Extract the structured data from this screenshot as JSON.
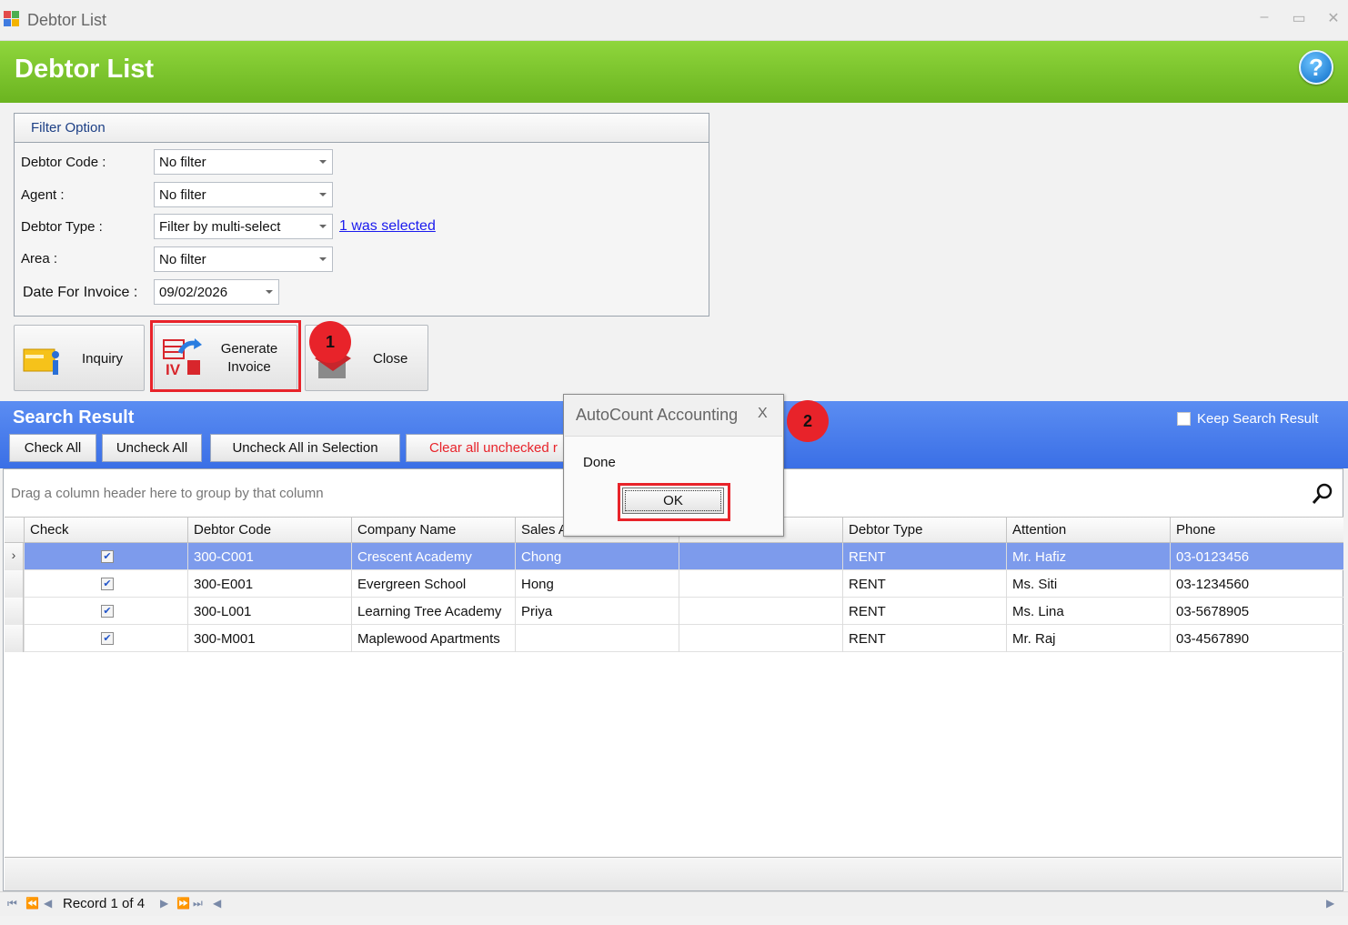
{
  "window": {
    "title": "Debtor List",
    "min": "–",
    "max": "▭",
    "close": "✕"
  },
  "header": {
    "title": "Debtor List",
    "help": "?"
  },
  "filter": {
    "caption": "Filter Option",
    "debtor_code_label": "Debtor Code :",
    "debtor_code_value": "No filter",
    "agent_label": "Agent :",
    "agent_value": "No filter",
    "debtor_type_label": "Debtor Type :",
    "debtor_type_value": "Filter by multi-select",
    "debtor_type_link": "1 was selected",
    "area_label": "Area :",
    "area_value": "No filter",
    "date_label": "Date For Invoice :",
    "date_value": "09/02/2026"
  },
  "actions": {
    "inquiry": "Inquiry",
    "generate_line1": "Generate",
    "generate_line2": "Invoice",
    "close": "Close"
  },
  "annotations": {
    "badge1": "1",
    "badge2": "2"
  },
  "search_result": {
    "title": "Search Result",
    "check_all": "Check All",
    "uncheck_all": "Uncheck All",
    "uncheck_all_selection": "Uncheck All in Selection",
    "clear_unchecked": "Clear all unchecked r",
    "keep_label": "Keep Search Result"
  },
  "grid": {
    "group_hint": "Drag a column header here to group by that column",
    "columns": [
      "Check",
      "Debtor Code",
      "Company Name",
      "Sales A",
      "",
      "Debtor Type",
      "Attention",
      "Phone"
    ],
    "rows": [
      {
        "code": "300-C001",
        "company": "Crescent Academy",
        "sales": "Chong",
        "type": "RENT",
        "attention": "Mr. Hafiz",
        "phone": "03-0123456"
      },
      {
        "code": "300-E001",
        "company": "Evergreen School",
        "sales": "Hong",
        "type": "RENT",
        "attention": "Ms. Siti",
        "phone": "03-1234560"
      },
      {
        "code": "300-L001",
        "company": "Learning Tree Academy",
        "sales": "Priya",
        "type": "RENT",
        "attention": "Ms. Lina",
        "phone": "03-5678905"
      },
      {
        "code": "300-M001",
        "company": "Maplewood Apartments",
        "sales": "",
        "type": "RENT",
        "attention": "Mr. Raj",
        "phone": "03-4567890"
      }
    ],
    "record_text": "Record 1 of 4"
  },
  "dialog": {
    "title": "AutoCount Accounting",
    "close": "X",
    "message": "Done",
    "ok": "OK"
  },
  "colors": {
    "header_green": "#7ac52a",
    "search_blue": "#3a6fe6",
    "selected_row": "#7d9bec",
    "annotation_red": "#e8232a"
  }
}
